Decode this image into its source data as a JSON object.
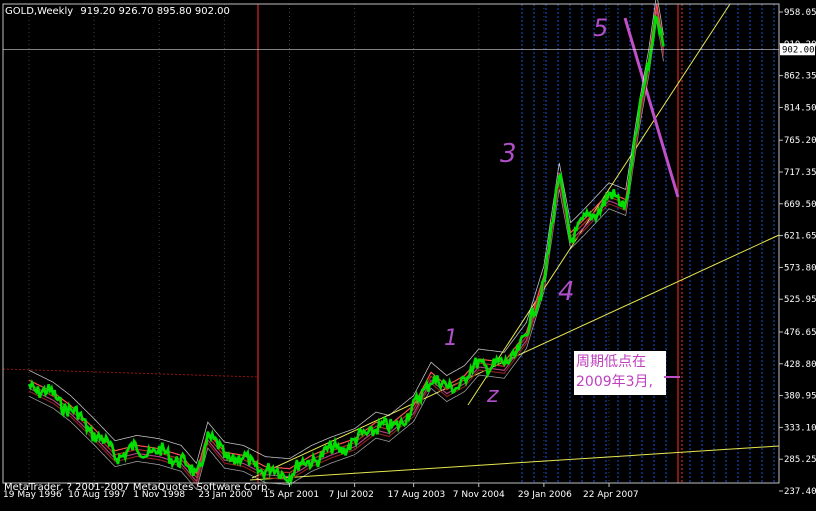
{
  "header": {
    "symbol": "GOLD,Weekly",
    "ohlc": "919.20 926.70 895.80 902.00"
  },
  "footer": {
    "copyright": "MetaTrader, ? 2001-2007 MetaQuotes Software Corp."
  },
  "annotation": {
    "line1": "周期低点在",
    "line2": "2009年3月,"
  },
  "wave_labels": [
    "1",
    "z",
    "3",
    "4",
    "5"
  ],
  "colors": {
    "background": "#000000",
    "grid": "#1e5cff",
    "axis": "#c0c0c0",
    "price": "#00e000",
    "ma": "#c0282c",
    "trend": "#e6e650",
    "marker": "#c050c8",
    "vline": "#ff3030"
  },
  "chart_data": {
    "type": "line",
    "title": "GOLD,Weekly",
    "y_ticks": [
      "958.05",
      "910.20",
      "862.35",
      "814.50",
      "765.20",
      "717.35",
      "669.50",
      "621.65",
      "573.80",
      "525.95",
      "476.65",
      "428.80",
      "380.95",
      "333.10",
      "285.25",
      "237.40"
    ],
    "x_ticks": [
      "19 May 1996",
      "10 Aug 1997",
      "1 Nov 1998",
      "23 Jan 2000",
      "15 Apr 2001",
      "7 Jul 2002",
      "17 Aug 2003",
      "7 Nov 2004",
      "29 Jan 2006",
      "22 Apr 2007"
    ],
    "current_price_label": "902.00",
    "ylim": [
      237.4,
      958.05
    ],
    "series": [
      {
        "values": [
          [
            "1996-05-19",
            398
          ],
          [
            "1996-11-01",
            380
          ],
          [
            "1997-03-01",
            360
          ],
          [
            "1997-08-10",
            325
          ],
          [
            "1998-01-01",
            292
          ],
          [
            "1998-06-01",
            300
          ],
          [
            "1998-11-01",
            295
          ],
          [
            "1999-04-01",
            285
          ],
          [
            "1999-07-15",
            258
          ],
          [
            "1999-10-01",
            320
          ],
          [
            "2000-01-23",
            290
          ],
          [
            "2000-06-01",
            285
          ],
          [
            "2000-11-01",
            268
          ],
          [
            "2001-04-15",
            265
          ],
          [
            "2001-09-15",
            285
          ],
          [
            "2002-02-01",
            298
          ],
          [
            "2002-07-07",
            310
          ],
          [
            "2002-12-01",
            335
          ],
          [
            "2003-03-01",
            330
          ],
          [
            "2003-08-17",
            360
          ],
          [
            "2003-12-15",
            410
          ],
          [
            "2004-04-01",
            390
          ],
          [
            "2004-08-01",
            405
          ],
          [
            "2004-11-07",
            430
          ],
          [
            "2005-05-01",
            425
          ],
          [
            "2005-10-01",
            470
          ],
          [
            "2006-01-29",
            555
          ],
          [
            "2006-05-15",
            710
          ],
          [
            "2006-08-01",
            620
          ],
          [
            "2006-11-01",
            640
          ],
          [
            "2007-04-22",
            680
          ],
          [
            "2007-08-15",
            670
          ],
          [
            "2007-11-15",
            800
          ],
          [
            "2008-01-20",
            880
          ],
          [
            "2008-03-15",
            965
          ],
          [
            "2008-05-01",
            902
          ]
        ]
      }
    ]
  }
}
